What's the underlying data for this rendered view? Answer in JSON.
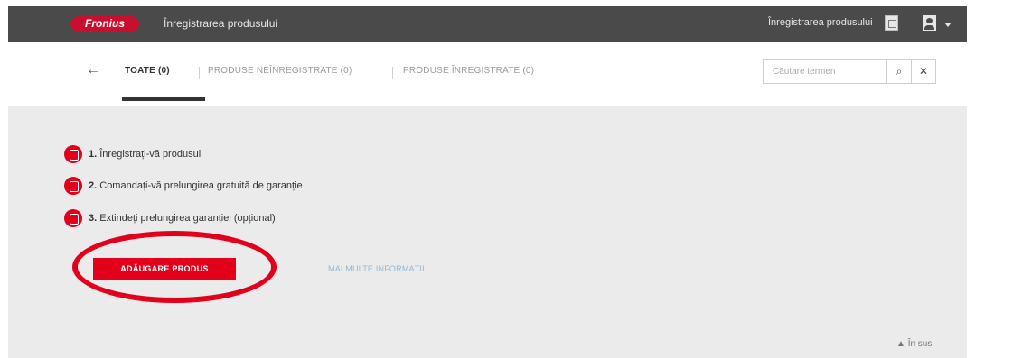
{
  "header": {
    "logo": "Fronius",
    "title": "Înregistrarea produsului",
    "user_link": "Înregistrarea produsului",
    "icons": [
      "registration-icon",
      "user-icon",
      "caret-down-icon"
    ]
  },
  "tabs": [
    {
      "label": "TOATE (0)",
      "active": true
    },
    {
      "label": "PRODUSE NEÎNREGISTRATE (0)",
      "active": false
    },
    {
      "label": "PRODUSE ÎNREGISTRATE (0)",
      "active": false
    }
  ],
  "search": {
    "placeholder": "Căutare termen",
    "search_glyph": "🔍",
    "clear_glyph": "✕"
  },
  "steps": [
    {
      "num": "1.",
      "text": "Înregistrați-vă produsul"
    },
    {
      "num": "2.",
      "text": "Comandați-vă prelungirea gratuită de garanție"
    },
    {
      "num": "3.",
      "text": "Extindeți prelungirea garanției (opțional)"
    }
  ],
  "actions": {
    "add_product": "ADĂUGARE PRODUS",
    "more_info": "MAI MULTE INFORMAȚII"
  },
  "footer": {
    "back_to_top": "În sus"
  },
  "colors": {
    "accent": "#e2001a",
    "topbar": "#4a4a4a",
    "content_bg": "#ebebeb"
  }
}
